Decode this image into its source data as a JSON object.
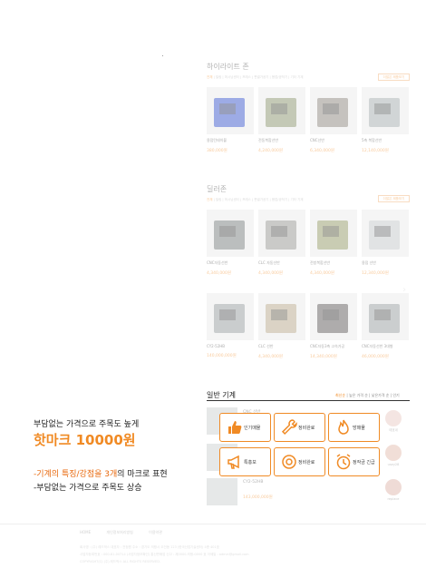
{
  "highlight": {
    "title": "하이라이트 존",
    "categories": [
      "전체",
      "밀링",
      "머시닝센터",
      "프레스",
      "판넬가공기",
      "용접/공작기",
      "기타 기계"
    ],
    "more_button": "더많은 제품보기",
    "products": [
      {
        "name": "용접턴테이블",
        "sub": "",
        "price": "380,000원",
        "loc": "",
        "tag": "",
        "color": "#2747c6"
      },
      {
        "name": "전동복합선반",
        "sub": "",
        "price": "4,240,000원",
        "loc": "",
        "tag": "",
        "color": "#7d8a60"
      },
      {
        "name": "CNC선반",
        "sub": "",
        "price": "6,340,000원",
        "loc": "",
        "tag": "",
        "color": "#7f7a70"
      },
      {
        "name": "5축 복합선반",
        "sub": "",
        "price": "12,140,000원",
        "loc": "",
        "tag": "",
        "color": "#9aa4a6"
      }
    ]
  },
  "deal": {
    "title": "딜러존",
    "categories": [
      "전체",
      "밀링",
      "머시닝센터",
      "프레스",
      "판넬가공기",
      "용접/공작기",
      "기타 기계"
    ],
    "more_button": "더많은 제품보기",
    "products": [
      {
        "name": "CNC자동선반",
        "sub": "",
        "price": "4,340,000원",
        "loc": "",
        "tag": "",
        "color": "#6b7070"
      },
      {
        "name": "CLC 자동선반",
        "sub": "",
        "price": "4,340,000원",
        "loc": "",
        "tag": "",
        "color": "#8b8c86"
      },
      {
        "name": "전방복합선반",
        "sub": "",
        "price": "4,340,000원",
        "loc": "",
        "tag": "",
        "color": "#8a8f58"
      },
      {
        "name": "용접 선반",
        "sub": "",
        "price": "12,340,000원",
        "loc": "",
        "tag": "",
        "color": "#bdc3c4"
      },
      {
        "name": "CY2-52HB",
        "sub": "",
        "price": "140,000,000원",
        "loc": "",
        "tag": "",
        "color": "#8b9194"
      },
      {
        "name": "CLC 선반",
        "sub": "",
        "price": "4,340,000원",
        "loc": "",
        "tag": "",
        "color": "#b0a080"
      },
      {
        "name": "CNC자동3축 고속가공",
        "sub": "",
        "price": "14,340,000원",
        "loc": "",
        "tag": "",
        "color": "#4d4a48"
      },
      {
        "name": "CNC자동선반 3대형",
        "sub": "",
        "price": "46,000,000원",
        "loc": "",
        "tag": "",
        "color": "#8e9396"
      }
    ]
  },
  "general": {
    "title": "일반 기계",
    "sort": [
      "최신순",
      "높은 가격 순",
      "낮은가격 순",
      "인기"
    ],
    "rows": [
      {
        "name": "CNC 선반",
        "sub": "",
        "price": ""
      },
      {
        "name": "",
        "sub": "",
        "price": ""
      },
      {
        "name": "CY2-52HB",
        "sub": "",
        "price": "143,000,000원"
      }
    ],
    "sellers": [
      {
        "name": "태호네",
        "color": "#e8c7c0"
      },
      {
        "name": "usey28",
        "color": "#e2b7a8"
      },
      {
        "name": "replace",
        "color": "#ddb1a5"
      }
    ]
  },
  "badges": [
    {
      "label": "인기매물",
      "icon": "thumbs-up-icon"
    },
    {
      "label": "정비완료",
      "icon": "wrench-icon"
    },
    {
      "label": "방매물",
      "icon": "fire-icon"
    },
    {
      "label": "특홍보",
      "icon": "megaphone-icon"
    },
    {
      "label": "정비완료",
      "icon": "gear-icon"
    },
    {
      "label": "정작금 긴급",
      "icon": "alarm-icon"
    }
  ],
  "promo": {
    "line1": "부담없는 가격으로 주목도 높게",
    "line2": "핫마크 10000원",
    "line3_a": "-기계의 특징/강점을 ",
    "line3_b": "3개",
    "line3_c": "의 마크로 표현",
    "line4": "-부담없는 가격으로 주목도 상승"
  },
  "footer": {
    "nav": [
      "HOME",
      "개인정보처리방침",
      "이용약관"
    ],
    "info": [
      "회사명 : (주) 레드박스    대표자 : 전정원    주소 : 경기도 의왕시 오전동 123 (한국산업기술센터) 4층 401호",
      "사업자등록번호 : 000-81-00714 (사업자정보확인)    통신판매업 신고 : 제0000-의왕-0000 호    이메일 : admin@gmail.com",
      "COPYRIGHT(C) (주) 레드박스 ALL RIGHTS RESERVED."
    ]
  }
}
